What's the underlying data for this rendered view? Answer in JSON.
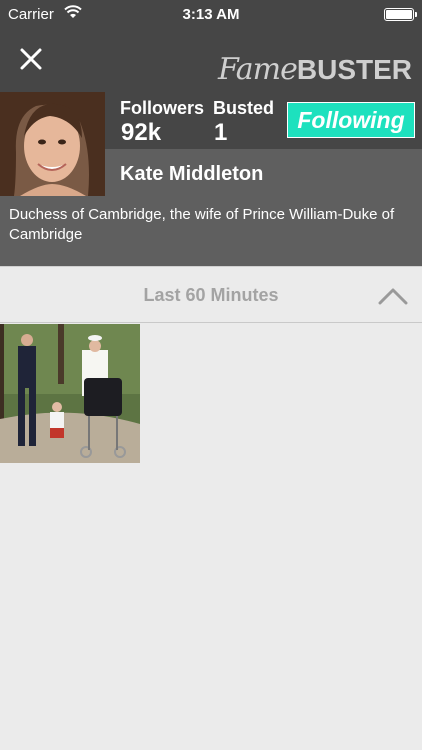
{
  "status_bar": {
    "carrier": "Carrier",
    "time": "3:13 AM"
  },
  "navbar": {
    "logo_part1": "Fame",
    "logo_part2": "BUSTER"
  },
  "profile": {
    "followers_label": "Followers",
    "followers_value": "92k",
    "busted_label": "Busted",
    "busted_value": "1",
    "follow_button": "Following",
    "name": "Kate Middleton",
    "bio": "Duchess of Cambridge, the wife of Prince William-Duke of Cambridge"
  },
  "section": {
    "title": "Last 60 Minutes"
  },
  "colors": {
    "accent": "#1de1be",
    "bar": "#464646",
    "panel": "#5f5f5f",
    "background": "#ebebeb"
  }
}
